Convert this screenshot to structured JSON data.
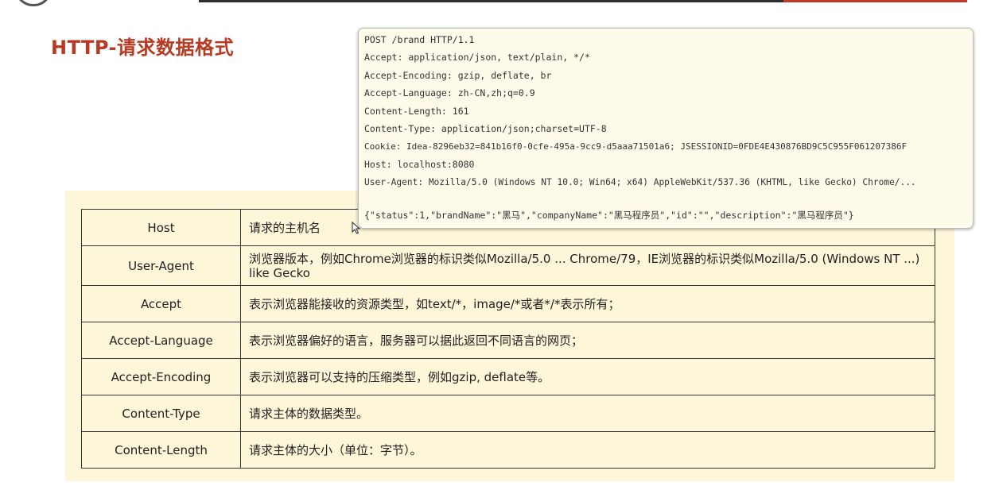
{
  "slide": {
    "title": "HTTP-请求数据格式"
  },
  "http_request": {
    "lines": [
      "POST /brand HTTP/1.1",
      "Accept: application/json, text/plain, */*",
      "Accept-Encoding: gzip, deflate, br",
      "Accept-Language: zh-CN,zh;q=0.9",
      "Content-Length: 161",
      "Content-Type: application/json;charset=UTF-8",
      "Cookie: Idea-8296eb32=841b16f0-0cfe-495a-9cc9-d5aaa71501a6; JSESSIONID=0FDE4E430876BD9C5C955F061207386F",
      "Host: localhost:8080",
      "User-Agent: Mozilla/5.0 (Windows NT 10.0; Win64; x64) AppleWebKit/537.36 (KHTML, like Gecko) Chrome/...",
      "{\"status\":1,\"brandName\":\"黑马\",\"companyName\":\"黑马程序员\",\"id\":\"\",\"description\":\"黑马程序员\"}"
    ]
  },
  "header_table": {
    "rows": [
      {
        "name": "Host",
        "desc": "请求的主机名"
      },
      {
        "name": "User-Agent",
        "desc": "浏览器版本，例如Chrome浏览器的标识类似Mozilla/5.0 ... Chrome/79，IE浏览器的标识类似Mozilla/5.0 (Windows NT ...) like Gecko"
      },
      {
        "name": "Accept",
        "desc": "表示浏览器能接收的资源类型，如text/*，image/*或者*/*表示所有；"
      },
      {
        "name": "Accept-Language",
        "desc": "表示浏览器偏好的语言，服务器可以据此返回不同语言的网页；"
      },
      {
        "name": "Accept-Encoding",
        "desc": "表示浏览器可以支持的压缩类型，例如gzip, deflate等。"
      },
      {
        "name": "Content-Type",
        "desc": "请求主体的数据类型。"
      },
      {
        "name": "Content-Length",
        "desc": "请求主体的大小（单位：字节）。"
      }
    ]
  }
}
